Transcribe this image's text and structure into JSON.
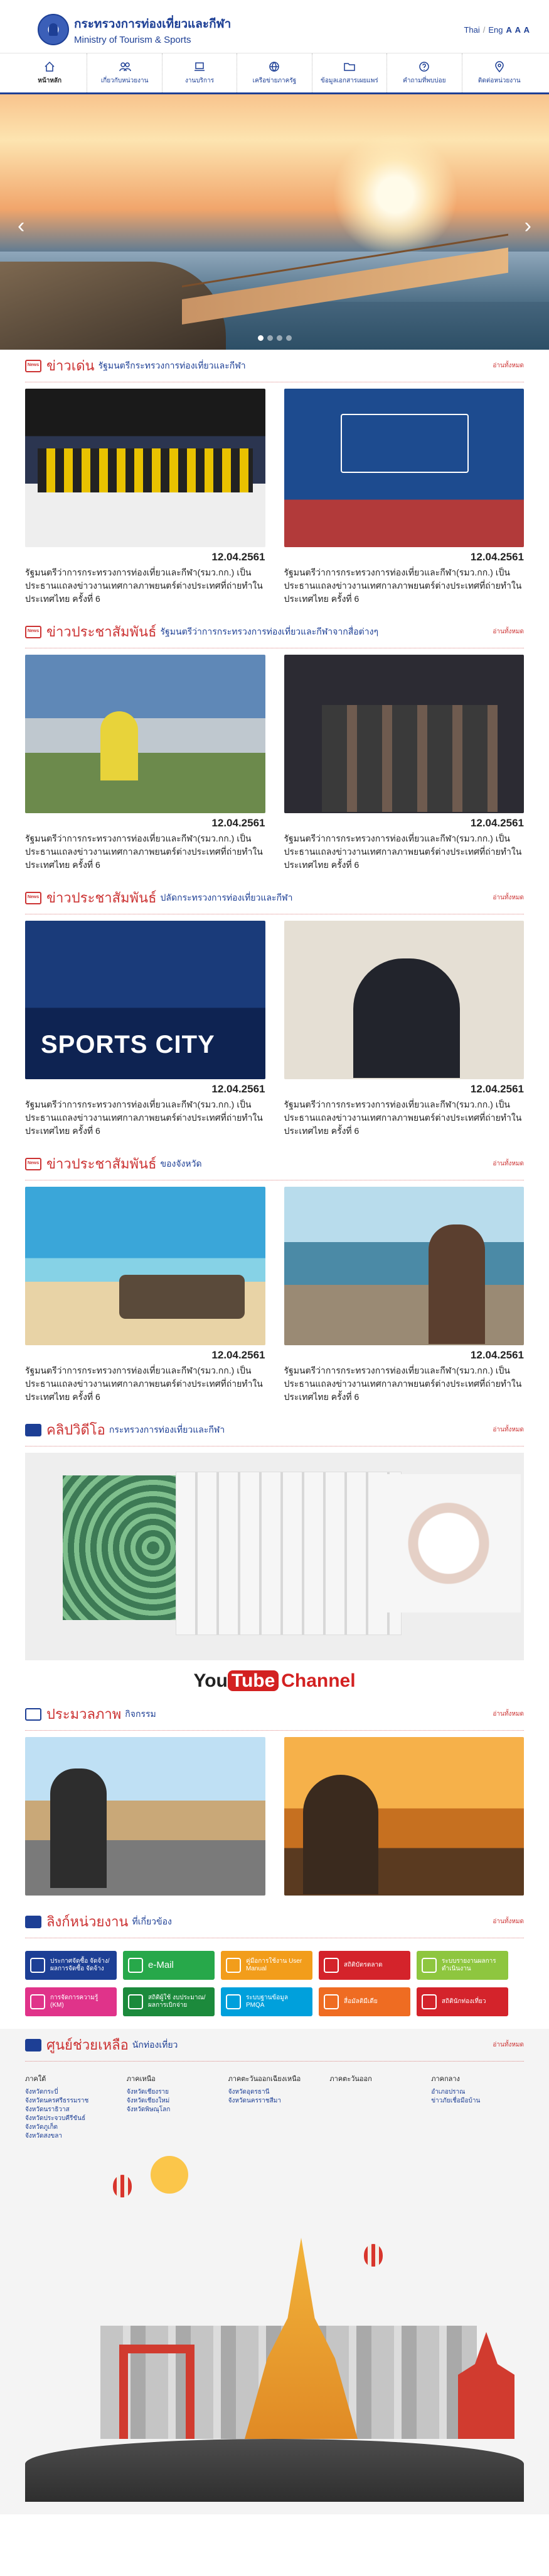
{
  "header": {
    "title_th": "กระทรวงการท่องเที่ยวและกีฬา",
    "title_en": "Ministry of Tourism & Sports",
    "lang_th": "Thai",
    "lang_en": "Eng",
    "font_sizes": "A A A"
  },
  "nav": [
    {
      "label": "หน้าหลัก",
      "icon": "home-icon",
      "active": true
    },
    {
      "label": "เกี่ยวกับหน่วยงาน",
      "icon": "people-icon"
    },
    {
      "label": "งานบริการ",
      "icon": "laptop-icon"
    },
    {
      "label": "เครือข่ายภาครัฐ",
      "icon": "globe-icon"
    },
    {
      "label": "ข้อมูลเอกสารเผยแพร่",
      "icon": "folder-icon"
    },
    {
      "label": "คำถามที่พบบ่อย",
      "icon": "question-icon"
    },
    {
      "label": "ติดต่อหน่วยงาน",
      "icon": "location-icon"
    }
  ],
  "more": "อ่านทั้งหมด",
  "sections": {
    "news_hot": {
      "title": "ข่าวเด่น",
      "subtitle": "รัฐมนตรีกระทรวงการท่องเที่ยวและกีฬา"
    },
    "pr_minister": {
      "title": "ข่าวประชาสัมพันธ์",
      "subtitle": "รัฐมนตรีว่าการกระทรวงการท่องเที่ยวและกีฬาจากสื่อต่างๆ"
    },
    "pr_ministry": {
      "title": "ข่าวประชาสัมพันธ์",
      "subtitle": "ปลัดกระทรวงการท่องเที่ยวและกีฬา"
    },
    "pr_province": {
      "title": "ข่าวประชาสัมพันธ์",
      "subtitle": "ของจังหวัด"
    },
    "video": {
      "title": "คลิปวิดีโอ",
      "subtitle": "กระทรวงการท่องเที่ยวและกีฬา"
    },
    "gallery": {
      "title": "ประมวลภาพ",
      "subtitle": "กิจกรรม"
    },
    "links": {
      "title": "ลิงก์หน่วยงาน",
      "subtitle": "ที่เกี่ยวข้อง"
    },
    "help": {
      "title": "ศูนย์ช่วยเหลือ",
      "subtitle": "นักท่องเที่ยว"
    }
  },
  "news": {
    "date": "12.04.2561",
    "caption": "รัฐมนตรีว่าการกระทรวงการท่องเที่ยวและกีฬา(รมว.กก.) เป็นประธานแถลงข่าวงานเทศกาลภาพยนตร์ต่างประเทศที่ถ่ายทำในประเทศไทย ครั้งที่ 6"
  },
  "youtube": {
    "you": "You",
    "tube": "Tube",
    "channel": "Channel"
  },
  "links": [
    {
      "label": "ประกาศจัดซื้อ จัดจ้าง/ผลการจัดซื้อ จัดจ้าง",
      "color": "#1d3f95",
      "big": false
    },
    {
      "label": "e-Mail",
      "color": "#27a84a",
      "big": true
    },
    {
      "label": "คู่มือการใช้งาน User Manual",
      "color": "#f29d1b",
      "big": false
    },
    {
      "label": "สถิติบัตรตลาด",
      "color": "#d4232b",
      "big": false
    },
    {
      "label": "ระบบรายงานผลการดำเนินงาน",
      "color": "#8ec63f",
      "big": false
    },
    {
      "label": "การจัดการความรู้ (KM)",
      "color": "#e0338a",
      "big": false
    },
    {
      "label": "สถิติผู้ใช้ งบประมาณ/ผลการเบิกจ่าย",
      "color": "#1c8a3c",
      "big": false
    },
    {
      "label": "ระบบฐานข้อมูล PMQA",
      "color": "#00a0dc",
      "big": false
    },
    {
      "label": "สื่อมัลติมีเดีย",
      "color": "#ef6c22",
      "big": false
    },
    {
      "label": "สถิตินักท่องเที่ยว",
      "color": "#d4232b",
      "big": false
    }
  ],
  "help": {
    "cols": [
      {
        "head": "ภาคใต้",
        "items": [
          "จังหวัดกระบี่",
          "จังหวัดนครศรีธรรมราช",
          "จังหวัดนราธิวาส",
          "จังหวัดประจวบคีรีขันธ์",
          "จังหวัดภูเก็ต",
          "จังหวัดสงขลา"
        ]
      },
      {
        "head": "ภาคเหนือ",
        "items": [
          "จังหวัดเชียงราย",
          "จังหวัดเชียงใหม่",
          "จังหวัดพิษณุโลก"
        ]
      },
      {
        "head": "ภาคตะวันออกเฉียงเหนือ",
        "items": [
          "จังหวัดอุดรธานี",
          "จังหวัดนครราชสีมา"
        ]
      },
      {
        "head": "ภาคตะวันออก",
        "items": []
      },
      {
        "head": "ภาคกลาง",
        "items": [
          "",
          "",
          "อำเภอปราณ",
          "ข่าวภัยเชื่อมือบ้าน"
        ]
      }
    ]
  }
}
